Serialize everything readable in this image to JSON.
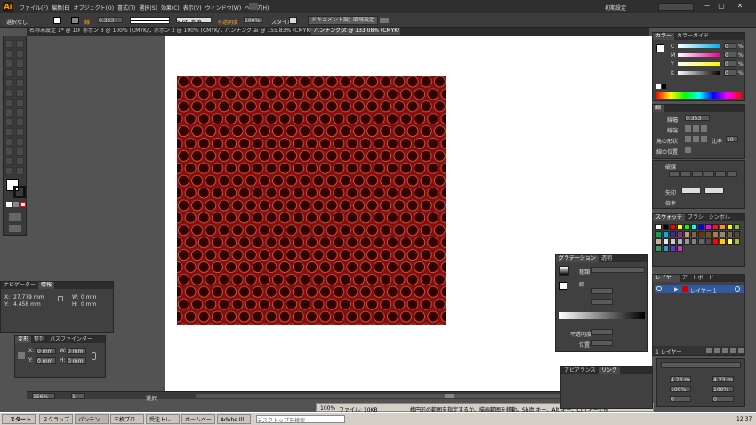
{
  "app": {
    "logo": "Ai",
    "menu": [
      "ファイル(F)",
      "編集(E)",
      "オブジェクト(O)",
      "書式(T)",
      "選択(S)",
      "効果(C)",
      "表示(V)",
      "ウィンドウ(W)",
      "ヘルプ(H)"
    ],
    "workspace_label": "初期設定",
    "search_placeholder": ""
  },
  "control_bar": {
    "selection_label": "選択なし",
    "stroke_label": "線",
    "stroke_weight": "0.353 ",
    "style_basic": "5 pt. 丸筆",
    "opacity_label": "不透明度",
    "opacity_value": "100%",
    "style_label": "スタイル",
    "doc_setup": "ドキュメント設定",
    "prefs": "環境設定"
  },
  "tabs": [
    {
      "label": "名称未設定 1* @ 100% (CMYK/プレビュー)"
    },
    {
      "label": "赤ポン 3 @ 100% (CMYK/プレビュー)"
    },
    {
      "label": "パンチング.ai @ 155.83% (CMYK/プレビュー)"
    },
    {
      "label": "パンチングpt @ 133.08% (CMYK/プレビュー)"
    }
  ],
  "status_bar": {
    "zoom": "156%",
    "page": "1",
    "mode": "選択"
  },
  "hint_bar": {
    "zoom": "100%",
    "file": "ファイル: 10KB",
    "message": "楕円形の範囲を指定するか、描画範囲を移動。Shift キー、Alt キー、Ctrl キーで他"
  },
  "color_panel": {
    "tabs": [
      "カラー",
      "カラーガイド"
    ],
    "channels": [
      {
        "label": "C",
        "value": "0",
        "unit": "%"
      },
      {
        "label": "M",
        "value": "0",
        "unit": "%"
      },
      {
        "label": "Y",
        "value": "0",
        "unit": "%"
      },
      {
        "label": "K",
        "value": "0",
        "unit": "%"
      }
    ]
  },
  "stroke_panel": {
    "tabs": [
      "線"
    ],
    "weight_label": "線幅",
    "weight_value": "0.353",
    "cap_label": "線端",
    "corner_label": "角の形状",
    "limit_label": "比率",
    "limit_value": "10",
    "align_label": "線の位置",
    "dashed_label": "破線",
    "arrow_label": "矢印",
    "scale_label": "倍率"
  },
  "swatch_panel": {
    "tabs": [
      "スウォッチ",
      "ブラシ",
      "シンボル"
    ],
    "colors": [
      "#ffffff",
      "#000000",
      "#ff0000",
      "#ffff00",
      "#00ff00",
      "#00ffff",
      "#0000ff",
      "#ff00ff",
      "#ed1c24",
      "#f7941d",
      "#fff200",
      "#8dc63f",
      "#00a651",
      "#00aeef",
      "#2e3192",
      "#92278f",
      "#c69c6d",
      "#8c6239",
      "#603913",
      "#754c24",
      "#a67c52",
      "#998675",
      "#736357",
      "#534741",
      "#c7b299",
      "#e6e6e6",
      "#cccccc",
      "#b3b3b3",
      "#999999",
      "#808080",
      "#666666",
      "#4d4d4d",
      "#ff0000",
      "#ffcc00",
      "#ffff66",
      "#99cc33",
      "#339966",
      "#3399cc",
      "#6633cc",
      "#cc33cc"
    ]
  },
  "layers_panel": {
    "tabs": [
      "レイヤー",
      "アートボード"
    ],
    "layers": [
      {
        "name": "レイヤー 1"
      }
    ],
    "footer": "1 レイヤー"
  },
  "gradient_panel": {
    "tabs": [
      "グラデーション",
      "透明"
    ],
    "type_label": "種類",
    "stroke_label": "線",
    "angle_label": "",
    "opacity_label": "不透明度",
    "location_label": "位置"
  },
  "appearance_panel": {
    "tabs": [
      "アピアランス",
      "リンク"
    ]
  },
  "info_panel": {
    "tabs": [
      "ナビゲーター",
      "情報"
    ],
    "x_label": "X:",
    "x_value": "27.779 mm",
    "y_label": "Y:",
    "y_value": "4.458 mm",
    "w_label": "W:",
    "w_value": "0 mm",
    "h_label": "H:",
    "h_value": "0 mm"
  },
  "transform_panel": {
    "tabs": [
      "変形",
      "整列",
      "パスファインダー"
    ],
    "x_label": "X:",
    "y_label": "Y:",
    "w_label": "W:",
    "h_label": "H:",
    "x_value": "0 mm",
    "y_value": "0 mm",
    "w_value": "0 mm",
    "h_value": "0 mm"
  },
  "char_panel": {
    "values": [
      "4.23 mm",
      "100%",
      "0",
      "100%",
      "0"
    ]
  },
  "taskbar": {
    "start": "スタート",
    "items": [
      "スクラップ...",
      "パンチン...",
      "三枚ブロ...",
      "受注トレ...",
      "ホームペー...",
      "Adobe Ill..."
    ],
    "address_placeholder": "デスクトップを検索",
    "clock": "12:37"
  }
}
